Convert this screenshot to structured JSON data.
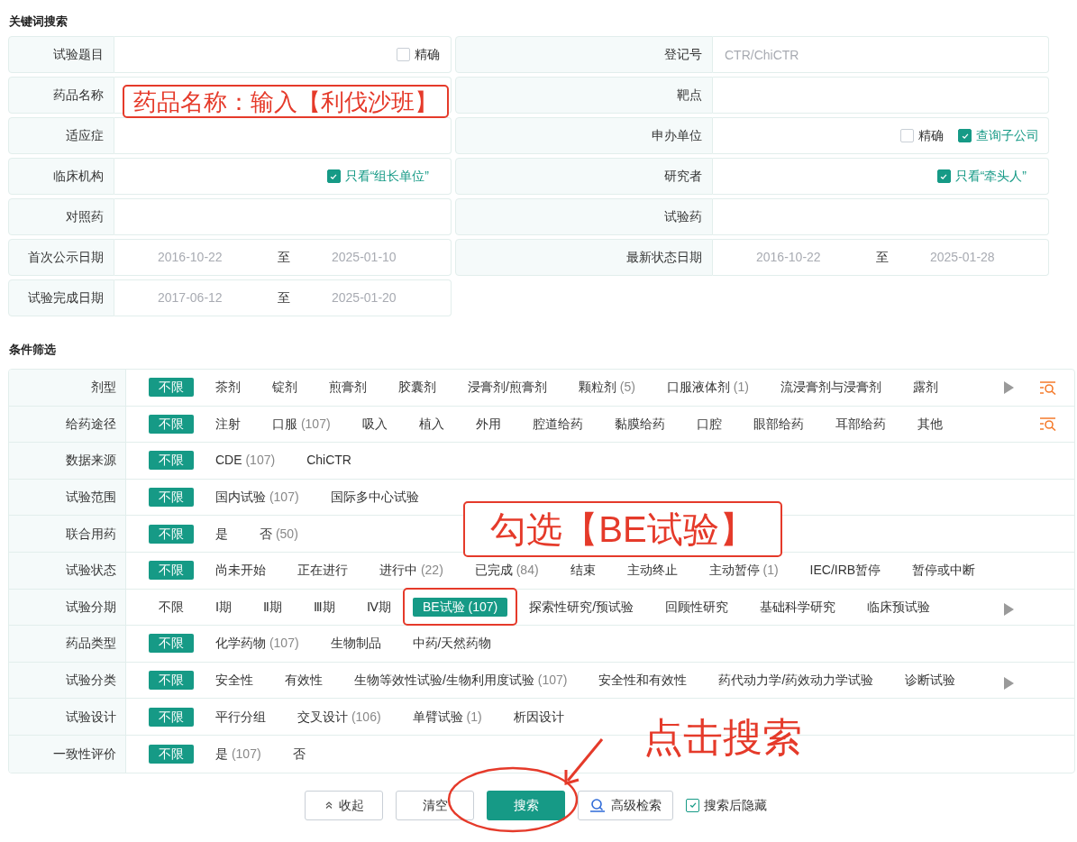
{
  "keyword_search": {
    "title": "关键词搜索",
    "fields": [
      {
        "label": "试验题目",
        "kind": "text",
        "checkboxes": [
          {
            "label": "精确",
            "checked": false
          }
        ]
      },
      {
        "label": "登记号",
        "kind": "text",
        "placeholder": "CTR/ChiCTR"
      },
      {
        "label": "药品名称",
        "kind": "text"
      },
      {
        "label": "靶点",
        "kind": "text"
      },
      {
        "label": "适应症",
        "kind": "text"
      },
      {
        "label": "申办单位",
        "kind": "text",
        "checkboxes": [
          {
            "label": "精确",
            "checked": false
          },
          {
            "label": "查询子公司",
            "checked": true
          }
        ]
      },
      {
        "label": "临床机构",
        "kind": "text",
        "checkboxes": [
          {
            "label": "只看“组长单位”",
            "checked": true
          }
        ]
      },
      {
        "label": "研究者",
        "kind": "text",
        "checkboxes": [
          {
            "label": "只看“牵头人”",
            "checked": true
          }
        ]
      },
      {
        "label": "对照药",
        "kind": "text"
      },
      {
        "label": "试验药",
        "kind": "text"
      },
      {
        "label": "首次公示日期",
        "kind": "date_range",
        "from": "2016-10-22",
        "separator": "至",
        "to": "2025-01-10"
      },
      {
        "label": "最新状态日期",
        "kind": "date_range",
        "from": "2016-10-22",
        "separator": "至",
        "to": "2025-01-28"
      },
      {
        "label": "试验完成日期",
        "kind": "date_range",
        "from": "2017-06-12",
        "separator": "至",
        "to": "2025-01-20"
      }
    ]
  },
  "filters": {
    "title": "条件筛选",
    "rows": [
      {
        "label": "剂型",
        "more": true,
        "filter_icon": true,
        "options": [
          {
            "text": "不限",
            "selected": true
          },
          {
            "text": "茶剂",
            "selected": false
          },
          {
            "text": "锭剂",
            "selected": false
          },
          {
            "text": "煎膏剂",
            "selected": false
          },
          {
            "text": "胶囊剂",
            "selected": false
          },
          {
            "text": "浸膏剂/煎膏剂",
            "selected": false
          },
          {
            "text": "颗粒剂",
            "count": "(5)",
            "selected": false
          },
          {
            "text": "口服液体剂",
            "count": "(1)",
            "selected": false
          },
          {
            "text": "流浸膏剂与浸膏剂",
            "selected": false
          },
          {
            "text": "露剂",
            "selected": false
          }
        ]
      },
      {
        "label": "给药途径",
        "more": false,
        "filter_icon": true,
        "options": [
          {
            "text": "不限",
            "selected": true
          },
          {
            "text": "注射",
            "selected": false
          },
          {
            "text": "口服",
            "count": "(107)",
            "selected": false
          },
          {
            "text": "吸入",
            "selected": false
          },
          {
            "text": "植入",
            "selected": false
          },
          {
            "text": "外用",
            "selected": false
          },
          {
            "text": "腔道给药",
            "selected": false
          },
          {
            "text": "黏膜给药",
            "selected": false
          },
          {
            "text": "口腔",
            "selected": false
          },
          {
            "text": "眼部给药",
            "selected": false
          },
          {
            "text": "耳部给药",
            "selected": false
          },
          {
            "text": "其他",
            "selected": false
          }
        ]
      },
      {
        "label": "数据来源",
        "more": false,
        "filter_icon": false,
        "options": [
          {
            "text": "不限",
            "selected": true
          },
          {
            "text": "CDE",
            "count": "(107)",
            "selected": false
          },
          {
            "text": "ChiCTR",
            "selected": false
          }
        ]
      },
      {
        "label": "试验范围",
        "more": false,
        "filter_icon": false,
        "options": [
          {
            "text": "不限",
            "selected": true
          },
          {
            "text": "国内试验",
            "count": "(107)",
            "selected": false
          },
          {
            "text": "国际多中心试验",
            "selected": false
          }
        ]
      },
      {
        "label": "联合用药",
        "more": false,
        "filter_icon": false,
        "options": [
          {
            "text": "不限",
            "selected": true
          },
          {
            "text": "是",
            "selected": false
          },
          {
            "text": "否",
            "count": "(50)",
            "selected": false
          }
        ]
      },
      {
        "label": "试验状态",
        "more": false,
        "filter_icon": false,
        "options": [
          {
            "text": "不限",
            "selected": true
          },
          {
            "text": "尚未开始",
            "selected": false
          },
          {
            "text": "正在进行",
            "selected": false
          },
          {
            "text": "进行中",
            "count": "(22)",
            "selected": false
          },
          {
            "text": "已完成",
            "count": "(84)",
            "selected": false
          },
          {
            "text": "结束",
            "selected": false
          },
          {
            "text": "主动终止",
            "selected": false
          },
          {
            "text": "主动暂停",
            "count": "(1)",
            "selected": false
          },
          {
            "text": "IEC/IRB暂停",
            "selected": false
          },
          {
            "text": "暂停或中断",
            "selected": false
          }
        ]
      },
      {
        "label": "试验分期",
        "more": true,
        "filter_icon": false,
        "options": [
          {
            "text": "不限",
            "selected": false
          },
          {
            "text": "Ⅰ期",
            "selected": false
          },
          {
            "text": "Ⅱ期",
            "selected": false
          },
          {
            "text": "Ⅲ期",
            "selected": false
          },
          {
            "text": "Ⅳ期",
            "selected": false
          },
          {
            "text": "BE试验",
            "count": "(107)",
            "selected": true,
            "circled": true
          },
          {
            "text": "探索性研究/预试验",
            "selected": false
          },
          {
            "text": "回顾性研究",
            "selected": false
          },
          {
            "text": "基础科学研究",
            "selected": false
          },
          {
            "text": "临床预试验",
            "selected": false
          }
        ]
      },
      {
        "label": "药品类型",
        "more": false,
        "filter_icon": false,
        "options": [
          {
            "text": "不限",
            "selected": true
          },
          {
            "text": "化学药物",
            "count": "(107)",
            "selected": false
          },
          {
            "text": "生物制品",
            "selected": false
          },
          {
            "text": "中药/天然药物",
            "selected": false
          }
        ]
      },
      {
        "label": "试验分类",
        "more": true,
        "filter_icon": false,
        "options": [
          {
            "text": "不限",
            "selected": true
          },
          {
            "text": "安全性",
            "selected": false
          },
          {
            "text": "有效性",
            "selected": false
          },
          {
            "text": "生物等效性试验/生物利用度试验",
            "count": "(107)",
            "selected": false
          },
          {
            "text": "安全性和有效性",
            "selected": false
          },
          {
            "text": "药代动力学/药效动力学试验",
            "selected": false
          },
          {
            "text": "诊断试验",
            "selected": false
          }
        ]
      },
      {
        "label": "试验设计",
        "more": false,
        "filter_icon": false,
        "options": [
          {
            "text": "不限",
            "selected": true
          },
          {
            "text": "平行分组",
            "selected": false
          },
          {
            "text": "交叉设计",
            "count": "(106)",
            "selected": false
          },
          {
            "text": "单臂试验",
            "count": "(1)",
            "selected": false
          },
          {
            "text": "析因设计",
            "selected": false
          }
        ]
      },
      {
        "label": "一致性评价",
        "more": false,
        "filter_icon": false,
        "options": [
          {
            "text": "不限",
            "selected": true
          },
          {
            "text": "是",
            "count": "(107)",
            "selected": false
          },
          {
            "text": "否",
            "selected": false
          }
        ]
      }
    ]
  },
  "actions": {
    "buttons": [
      {
        "label": "收起",
        "kind": "collapse"
      },
      {
        "label": "清空",
        "kind": "plain"
      },
      {
        "label": "搜索",
        "kind": "primary",
        "circled": true
      },
      {
        "label": "高级检索",
        "kind": "advanced"
      }
    ],
    "hide_after_search": {
      "label": "搜索后隐藏",
      "checked": true
    }
  },
  "annotations": [
    {
      "kind": "boxed",
      "text": "药品名称：输入【利伐沙班】"
    },
    {
      "kind": "boxed",
      "text": "勾选【BE试验】"
    },
    {
      "kind": "arrow_text",
      "text": "点击搜索"
    }
  ]
}
